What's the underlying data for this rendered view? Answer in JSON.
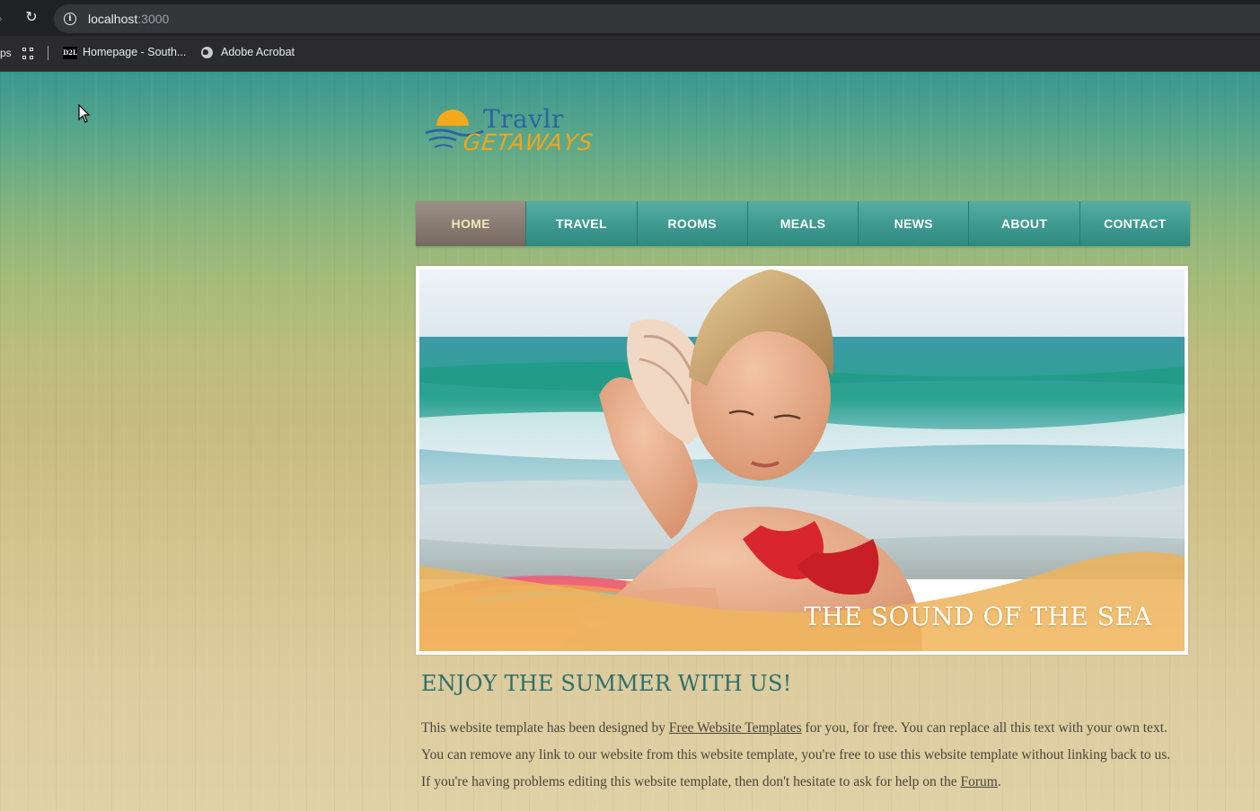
{
  "browser": {
    "url_host": "localhost",
    "url_path": ":3000",
    "bookmarks_fragment": "ps",
    "bookmarks": [
      {
        "label": "Homepage - South...",
        "icon": "d2l-icon"
      },
      {
        "label": "Adobe Acrobat",
        "icon": "globe-icon"
      }
    ],
    "d2l_text": "D2L"
  },
  "site": {
    "logo_line1": "Travlr",
    "logo_line2": "GETAWAYS",
    "nav": [
      {
        "label": "HOME",
        "active": true
      },
      {
        "label": "TRAVEL",
        "active": false
      },
      {
        "label": "ROOMS",
        "active": false
      },
      {
        "label": "MEALS",
        "active": false
      },
      {
        "label": "NEWS",
        "active": false
      },
      {
        "label": "ABOUT",
        "active": false
      },
      {
        "label": "CONTACT",
        "active": false
      }
    ],
    "hero_caption": "THE SOUND OF THE SEA",
    "heading": "ENJOY THE SUMMER WITH US!",
    "body": {
      "p1": "This website template has been designed by ",
      "link1": "Free Website Templates",
      "p2": " for you, for free. You can replace all this text with your own text. You can remove any link to our website from this website template, you're free to use this website template without linking back to us. If you're having problems editing this website template, then don't hesitate to ask for help on the ",
      "link2": "Forum",
      "p3": "."
    }
  },
  "colors": {
    "nav_teal": "#3f9b91",
    "nav_active": "#85796f",
    "heading": "#2f6f6a",
    "logo_blue": "#2e63a4",
    "logo_orange": "#f0a51f"
  }
}
